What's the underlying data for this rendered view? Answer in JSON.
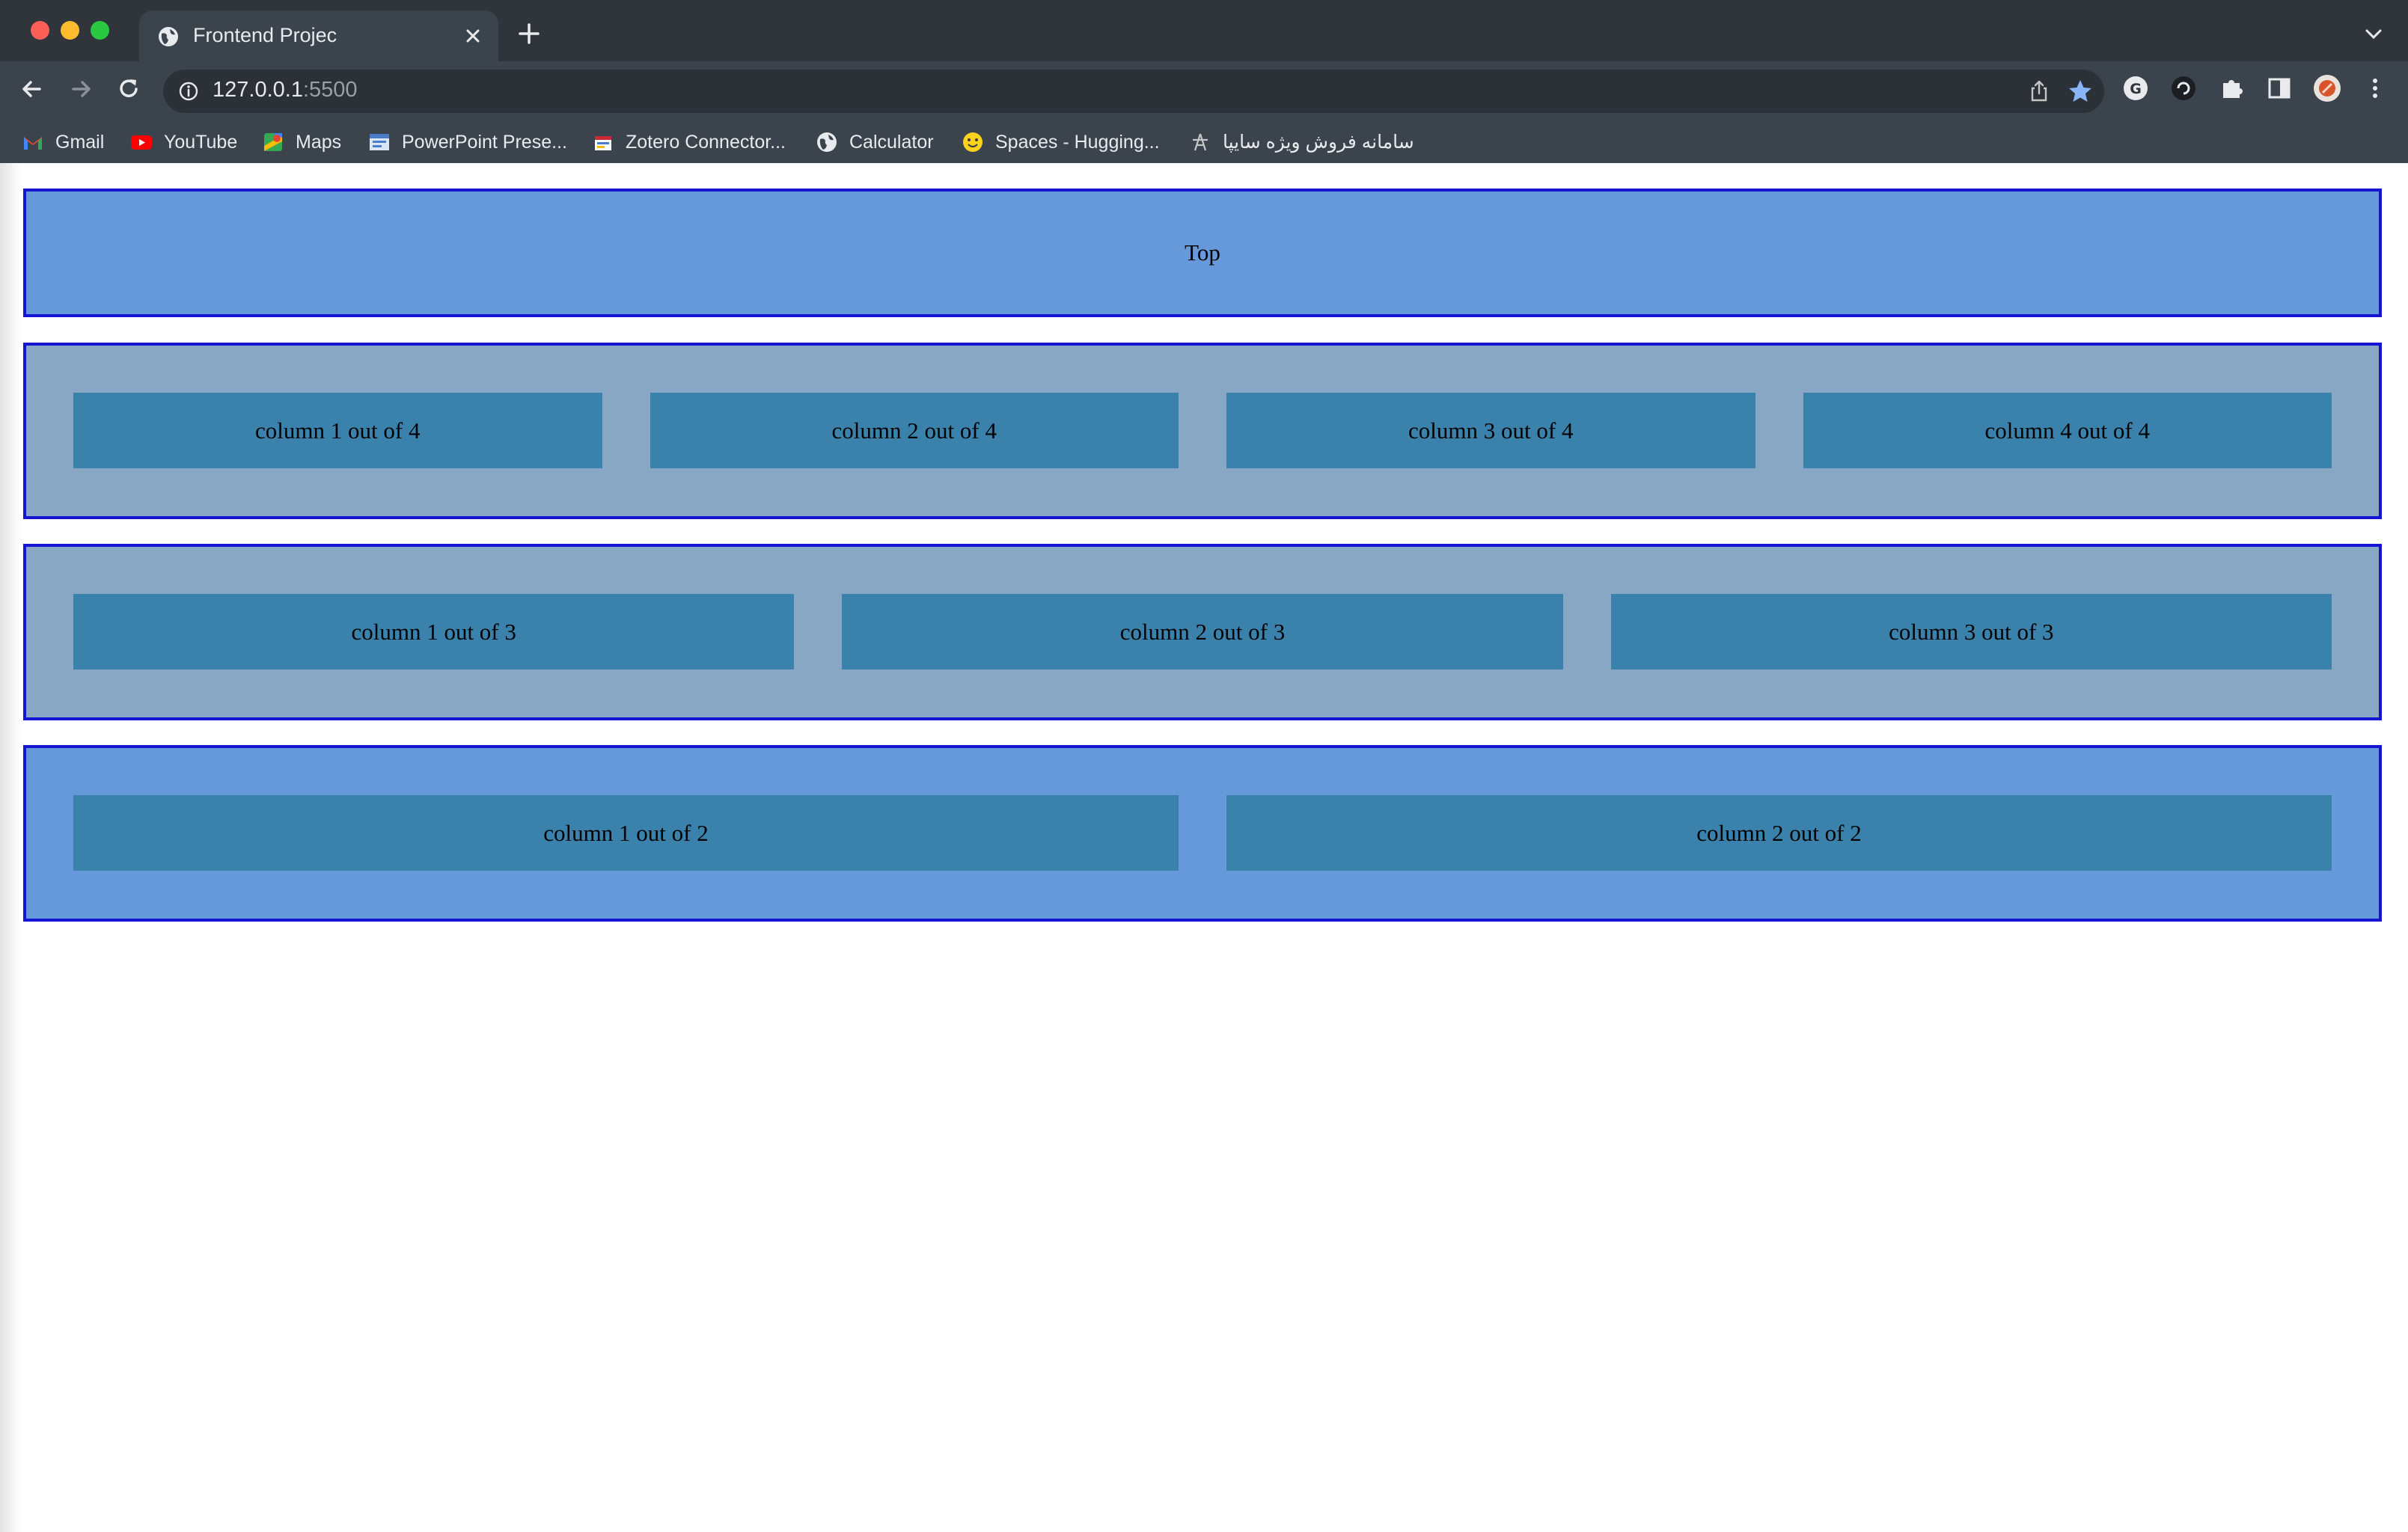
{
  "browser": {
    "tab_title": "Frontend Projec",
    "url_host": "127.0.0.1",
    "url_port": ":5500",
    "bookmarks": [
      {
        "label": "Gmail",
        "icon": "gmail-icon"
      },
      {
        "label": "YouTube",
        "icon": "youtube-icon"
      },
      {
        "label": "Maps",
        "icon": "maps-icon"
      },
      {
        "label": "PowerPoint Prese...",
        "icon": "powerpoint-icon"
      },
      {
        "label": "Zotero Connector...",
        "icon": "zotero-icon"
      },
      {
        "label": "Calculator",
        "icon": "globe-icon"
      },
      {
        "label": "Spaces - Hugging...",
        "icon": "huggingface-icon"
      },
      {
        "label": "سامانه فروش ویژه سایپا",
        "icon": "saipa-icon"
      }
    ],
    "colors": {
      "titlebar": "#2f353b",
      "toolbar": "#3b444c",
      "star": "#8ab4f8"
    }
  },
  "page": {
    "top_label": "Top",
    "row4": [
      "column 1 out of 4",
      "column 2 out of 4",
      "column 3 out of 4",
      "column 4 out of 4"
    ],
    "row3": [
      "column 1 out of 3",
      "column 2 out of 3",
      "column 3 out of 3"
    ],
    "row2": [
      "column 1 out of 2",
      "column 2 out of 2"
    ],
    "colors": {
      "border": "#1414d2",
      "blue_row": "#6699d9",
      "gray_row": "#88a7c5",
      "column": "#3a82ab"
    }
  }
}
